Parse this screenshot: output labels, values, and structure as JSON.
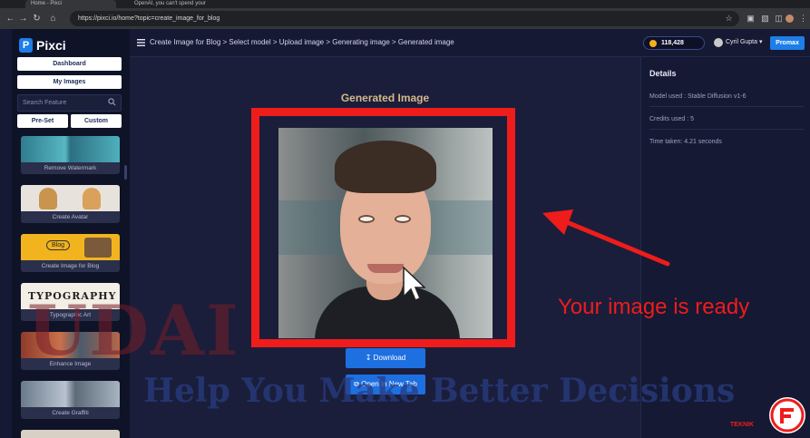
{
  "browser": {
    "tabs": [
      {
        "label": "Home - Pixci"
      },
      {
        "label": "OpenAI, you can't spend your"
      }
    ],
    "url": "https://pixci.io/home?topic=create_image_for_blog"
  },
  "sidebar": {
    "logo_text": "Pixci",
    "dashboard_label": "Dashboard",
    "my_images_label": "My Images",
    "search_placeholder": "Search Feature",
    "preset_label": "Pre-Set",
    "custom_label": "Custom",
    "features": [
      {
        "label": "Remove Watermark"
      },
      {
        "label": "Create Avatar"
      },
      {
        "label": "Create Image for Blog",
        "thumb_text": "Blog"
      },
      {
        "label": "Typographic Art",
        "thumb_text": "TYPOGRAPHY"
      },
      {
        "label": "Enhance Image"
      },
      {
        "label": "Create Graffiti"
      }
    ]
  },
  "header": {
    "breadcrumb": "Create Image for Blog > Select model > Upload image > Generating image > Generated image",
    "credits": "118,428",
    "username": "Cyril Gupta",
    "plan_label": "Promax"
  },
  "main": {
    "title": "Generated Image",
    "download_label": "Download",
    "new_tab_label": "Open In New Tab"
  },
  "details": {
    "title": "Details",
    "model": "Model used : Stable Diffusion v1-6",
    "credits_used": "Credits used : 5",
    "time_taken": "Time taken: 4.21 seconds"
  },
  "overlay": {
    "annotation": "Your image is ready",
    "watermark_tagline": "Help You Make Better Decisions",
    "watermark_brand": "UDAI",
    "corner_brand": "TEKNIK",
    "accent_color": "#ef1c1c"
  }
}
